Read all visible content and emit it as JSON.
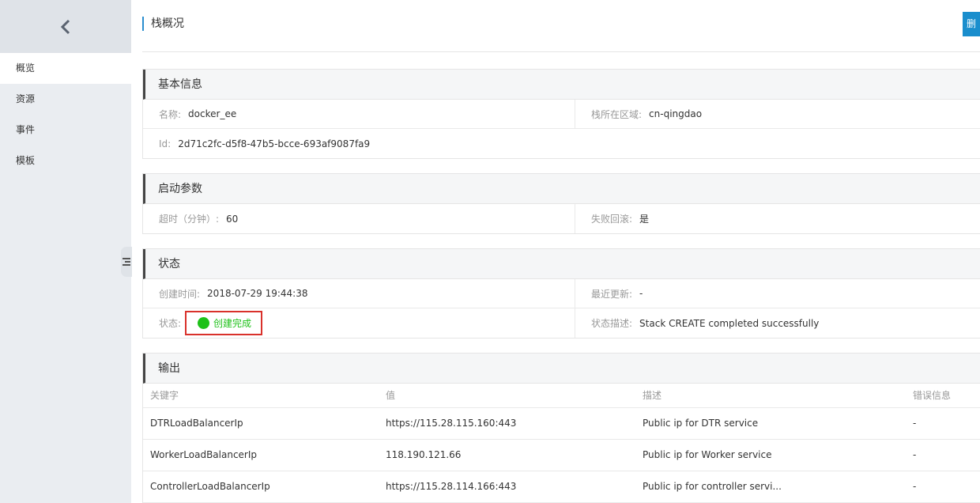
{
  "sidebar": {
    "back_icon": "chevron-left-icon",
    "items": [
      {
        "label": "概览"
      },
      {
        "label": "资源"
      },
      {
        "label": "事件"
      },
      {
        "label": "模板"
      }
    ],
    "collapse_icon": "menu-collapse-icon"
  },
  "header": {
    "title": "栈概况",
    "button_label": "删"
  },
  "basic_info": {
    "title": "基本信息",
    "name_label": "名称:",
    "name_value": "docker_ee",
    "region_label": "栈所在区域:",
    "region_value": "cn-qingdao",
    "id_label": "Id:",
    "id_value": "2d71c2fc-d5f8-47b5-bcce-693af9087fa9"
  },
  "launch_params": {
    "title": "启动参数",
    "timeout_label": "超时（分钟）:",
    "timeout_value": "60",
    "rollback_label": "失败回滚:",
    "rollback_value": "是"
  },
  "status": {
    "title": "状态",
    "created_label": "创建时间:",
    "created_value": "2018-07-29 19:44:38",
    "updated_label": "最近更新:",
    "updated_value": "-",
    "status_label": "状态:",
    "status_value": "创建完成",
    "status_color": "#1ec119",
    "desc_label": "状态描述:",
    "desc_value": "Stack CREATE completed successfully"
  },
  "outputs": {
    "title": "输出",
    "columns": [
      "关键字",
      "值",
      "描述",
      "错误信息"
    ],
    "rows": [
      [
        "DTRLoadBalancerIp",
        "https://115.28.115.160:443",
        "Public ip for DTR service",
        "-"
      ],
      [
        "WorkerLoadBalancerIp",
        "118.190.121.66",
        "Public ip for Worker service",
        "-"
      ],
      [
        "ControllerLoadBalancerIp",
        "https://115.28.114.166:443",
        "Public ip for controller servi...",
        "-"
      ]
    ]
  }
}
